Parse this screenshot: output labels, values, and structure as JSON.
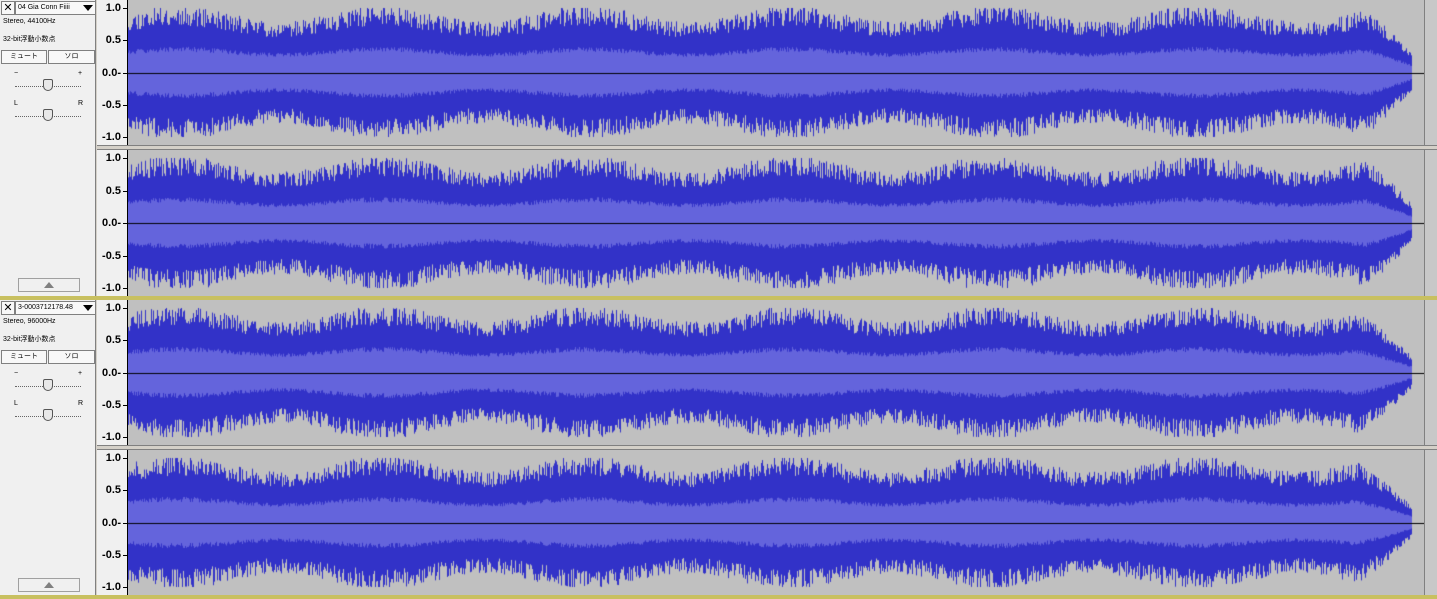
{
  "tracks": [
    {
      "close_glyph": "✕",
      "name": "04 Gia Conn Fiiii",
      "format": "Stereo, 44100Hz",
      "sample_format": "32-bit浮動小数点",
      "mute_label": "ミュート",
      "solo_label": "ソロ",
      "gain_minus": "−",
      "gain_plus": "+",
      "pan_left": "L",
      "pan_right": "R",
      "gain": 0.5,
      "pan": 0.5,
      "scale_labels": [
        "1.0",
        "0.5",
        "0.0-",
        "-0.5",
        "-1.0"
      ]
    },
    {
      "close_glyph": "✕",
      "name": "3-0003712178.48",
      "format": "Stereo, 96000Hz",
      "sample_format": "32-bit浮動小数点",
      "mute_label": "ミュート",
      "solo_label": "ソロ",
      "gain_minus": "−",
      "gain_plus": "+",
      "pan_left": "L",
      "pan_right": "R",
      "gain": 0.5,
      "pan": 0.5,
      "scale_labels": [
        "1.0",
        "0.5",
        "0.0-",
        "-0.5",
        "-1.0"
      ]
    }
  ],
  "colors": {
    "waveform_peak": "#3232c8",
    "waveform_rms": "#6464dc",
    "waveform_bg": "#c0c0c0",
    "center_line": "#000000"
  },
  "icons": {
    "close": "close-icon",
    "menu": "chevron-down-icon",
    "collapse": "collapse-up-icon",
    "slider_thumb": "slider-thumb-icon"
  }
}
